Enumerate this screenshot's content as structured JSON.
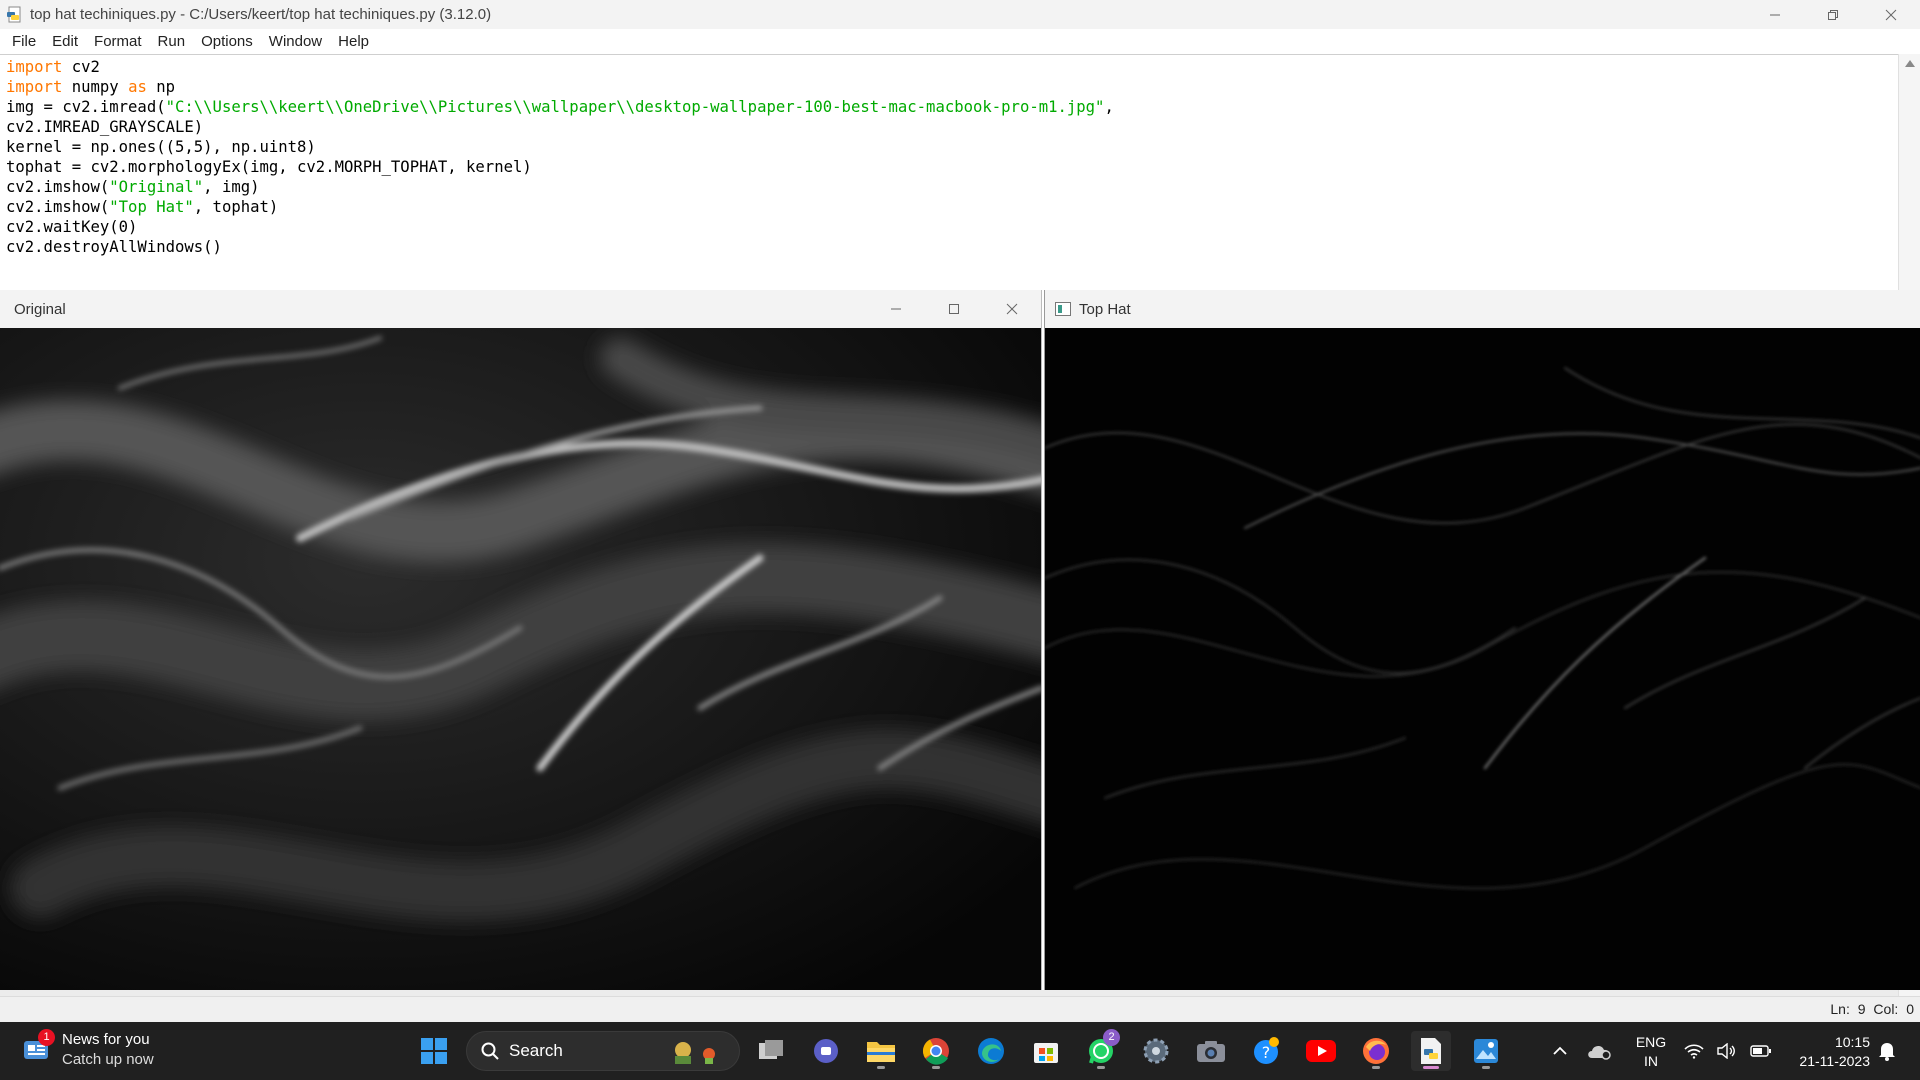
{
  "idle_window": {
    "title": "top hat techiniques.py - C:/Users/keert/top hat techiniques.py (3.12.0)",
    "menu": [
      "File",
      "Edit",
      "Format",
      "Run",
      "Options",
      "Window",
      "Help"
    ],
    "code_lines": [
      [
        {
          "t": "import",
          "c": "kw"
        },
        {
          "t": " cv2",
          "c": ""
        }
      ],
      [
        {
          "t": "import",
          "c": "kw"
        },
        {
          "t": " numpy ",
          "c": ""
        },
        {
          "t": "as",
          "c": "kw"
        },
        {
          "t": " np",
          "c": ""
        }
      ],
      [
        {
          "t": "img = cv2.imread(",
          "c": ""
        },
        {
          "t": "\"C:\\\\Users\\\\keert\\\\OneDrive\\\\Pictures\\\\wallpaper\\\\desktop-wallpaper-100-best-mac-macbook-pro-m1.jpg\"",
          "c": "str"
        },
        {
          "t": ",",
          "c": ""
        }
      ],
      [
        {
          "t": "cv2.IMREAD_GRAYSCALE)",
          "c": ""
        }
      ],
      [
        {
          "t": "kernel = np.ones((5,5), np.uint8)",
          "c": ""
        }
      ],
      [
        {
          "t": "tophat = cv2.morphologyEx(img, cv2.MORPH_TOPHAT, kernel)",
          "c": ""
        }
      ],
      [
        {
          "t": "cv2.imshow(",
          "c": ""
        },
        {
          "t": "\"Original\"",
          "c": "str"
        },
        {
          "t": ", img)",
          "c": ""
        }
      ],
      [
        {
          "t": "cv2.imshow(",
          "c": ""
        },
        {
          "t": "\"Top Hat\"",
          "c": "str"
        },
        {
          "t": ", tophat)",
          "c": ""
        }
      ],
      [
        {
          "t": "cv2.waitKey(0)",
          "c": ""
        }
      ],
      [
        {
          "t": "cv2.destroyAllWindows()",
          "c": ""
        }
      ]
    ],
    "status": "Ln: 9   Col: 0"
  },
  "original_window": {
    "title": "Original"
  },
  "tophat_window": {
    "title": "Top Hat"
  },
  "taskbar": {
    "news_title": "News for you",
    "news_subtitle": "Catch up now",
    "news_badge": "1",
    "search_label": "Search",
    "whatsapp_badge": "2",
    "lang_line1": "ENG",
    "lang_line2": "IN",
    "time": "10:15",
    "date": "21-11-2023"
  },
  "colors": {
    "keyword": "#ff7700",
    "string": "#00aa00",
    "taskbar_bg": "#202020",
    "accent": "#0078d4"
  },
  "icons": [
    "python-file-icon",
    "windows-start-icon",
    "search-icon",
    "task-view-icon",
    "teams-chat-icon",
    "file-explorer-icon",
    "chrome-icon",
    "edge-icon",
    "microsoft-store-icon",
    "whatsapp-icon",
    "settings-icon",
    "camera-icon",
    "get-help-icon",
    "youtube-icon",
    "firefox-icon",
    "idle-icon",
    "photos-icon",
    "chevron-up-icon",
    "onedrive-icon",
    "wifi-icon",
    "volume-icon",
    "battery-icon",
    "notification-bell-icon"
  ]
}
